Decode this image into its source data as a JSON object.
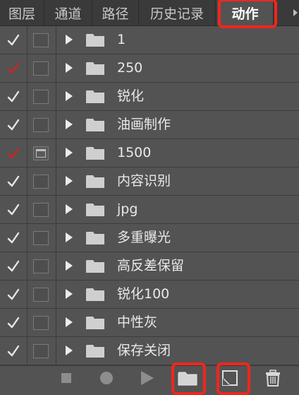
{
  "tabs": [
    {
      "label": "图层",
      "active": false
    },
    {
      "label": "通道",
      "active": false
    },
    {
      "label": "路径",
      "active": false
    },
    {
      "label": "历史记录",
      "active": false
    },
    {
      "label": "动作",
      "active": true
    }
  ],
  "panel_menu_icon": "panel-menu-icon",
  "colors": {
    "panel_bg": "#535353",
    "tabbar_bg": "#3a3a3a",
    "text": "#e9e9e9",
    "check_white": "#e6e6e6",
    "check_red": "#d32222",
    "highlight": "#f0261c"
  },
  "actions": [
    {
      "label": "1",
      "enabled": true,
      "check_color": "white",
      "dialog": false
    },
    {
      "label": "250",
      "enabled": true,
      "check_color": "red",
      "dialog": false
    },
    {
      "label": "锐化",
      "enabled": true,
      "check_color": "white",
      "dialog": false
    },
    {
      "label": "油画制作",
      "enabled": true,
      "check_color": "white",
      "dialog": false
    },
    {
      "label": "1500",
      "enabled": true,
      "check_color": "red",
      "dialog": true
    },
    {
      "label": "内容识别",
      "enabled": true,
      "check_color": "white",
      "dialog": false
    },
    {
      "label": "jpg",
      "enabled": true,
      "check_color": "white",
      "dialog": false
    },
    {
      "label": "多重曝光",
      "enabled": true,
      "check_color": "white",
      "dialog": false
    },
    {
      "label": "高反差保留",
      "enabled": true,
      "check_color": "white",
      "dialog": false
    },
    {
      "label": "锐化100",
      "enabled": true,
      "check_color": "white",
      "dialog": false
    },
    {
      "label": "中性灰",
      "enabled": true,
      "check_color": "white",
      "dialog": false
    },
    {
      "label": "保存关闭",
      "enabled": true,
      "check_color": "white",
      "dialog": false
    }
  ],
  "toolbar": [
    {
      "icon": "stop-icon",
      "enabled": false
    },
    {
      "icon": "record-icon",
      "enabled": false
    },
    {
      "icon": "play-icon",
      "enabled": false
    },
    {
      "icon": "new-set-folder-icon",
      "enabled": true,
      "highlighted": true
    },
    {
      "icon": "new-action-icon",
      "enabled": true,
      "highlighted": true
    },
    {
      "icon": "trash-icon",
      "enabled": true
    }
  ]
}
